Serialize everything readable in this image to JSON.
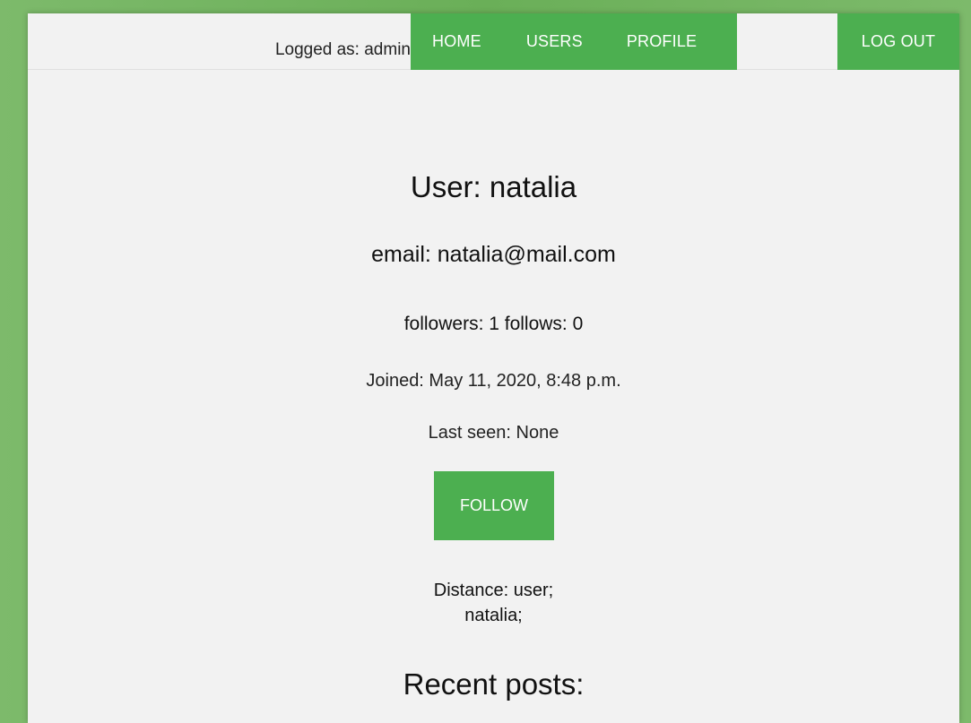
{
  "header": {
    "logged_as": "Logged as: admin",
    "nav": {
      "home": "HOME",
      "users": "USERS",
      "profile": "PROFILE",
      "logout": "LOG OUT"
    }
  },
  "profile": {
    "title": "User: natalia",
    "email": "email: natalia@mail.com",
    "follow_stats": "followers: 1 follows: 0",
    "joined": "Joined: May 11, 2020, 8:48 p.m.",
    "last_seen": "Last seen: None",
    "follow_button": "FOLLOW",
    "distance_line1": "Distance: user;",
    "distance_line2": "natalia;",
    "recent_posts_heading": "Recent posts:"
  },
  "colors": {
    "accent": "#4caf50",
    "background": "#6aaf58",
    "panel": "#f2f2f2"
  }
}
